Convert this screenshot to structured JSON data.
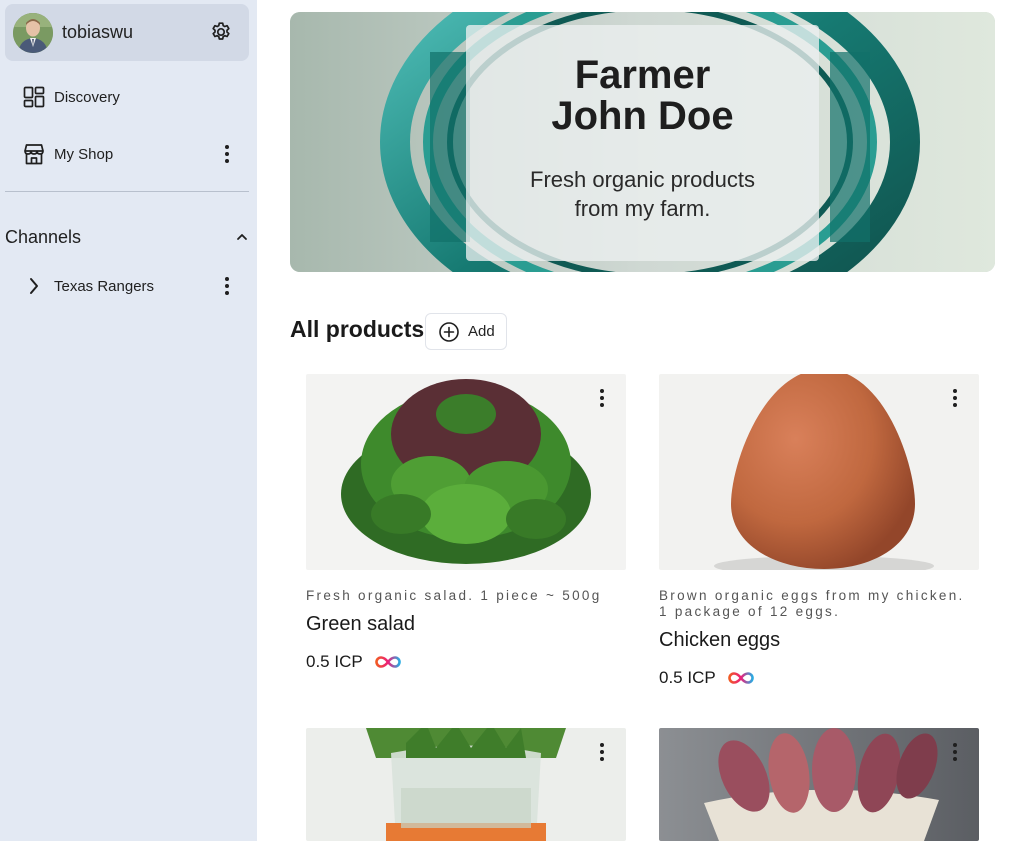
{
  "sidebar": {
    "user": {
      "name": "tobiaswu"
    },
    "nav": [
      {
        "label": "Discovery",
        "icon": "dashboard-icon"
      },
      {
        "label": "My Shop",
        "icon": "store-icon"
      }
    ],
    "channels": {
      "heading": "Channels",
      "items": [
        {
          "label": "Texas Rangers"
        }
      ]
    }
  },
  "banner": {
    "title": "Farmer\nJohn Doe",
    "subtitle": "Fresh organic products\nfrom my farm."
  },
  "products": {
    "heading": "All products",
    "add_label": "Add",
    "items": [
      {
        "description": "Fresh organic salad. 1 piece ~ 500g",
        "name": "Green salad",
        "price": "0.5 ICP",
        "image": "green-salad"
      },
      {
        "description": "Brown organic eggs from my chicken. 1 package of 12 eggs.",
        "name": "Chicken eggs",
        "price": "0.5 ICP",
        "image": "egg"
      },
      {
        "description": "",
        "name": "",
        "price": "",
        "image": "carrots"
      },
      {
        "description": "",
        "name": "",
        "price": "",
        "image": "sweet-potatoes"
      }
    ]
  },
  "colors": {
    "sidebar_bg": "#e3e9f3",
    "user_card_bg": "#d2d9e6",
    "banner_teal": "#1f8f86",
    "icp_gradient_left": "#f15a24",
    "icp_gradient_right": "#29abe2"
  }
}
